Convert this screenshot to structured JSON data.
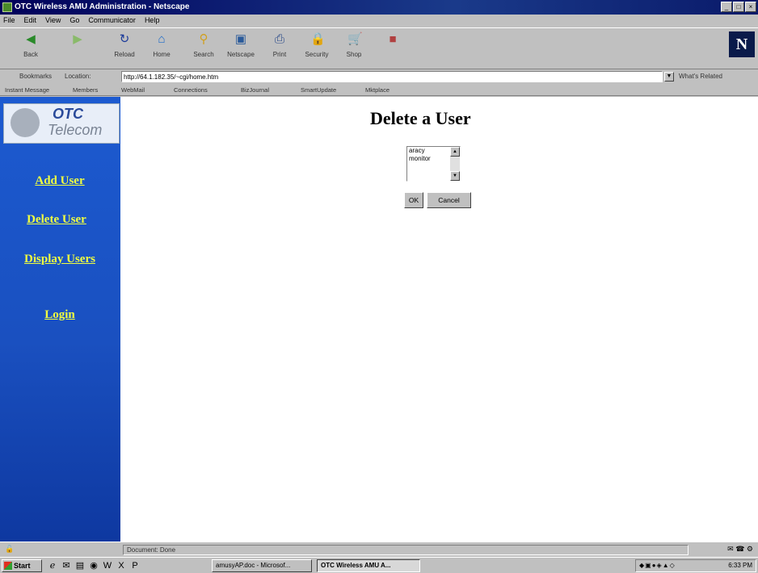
{
  "window": {
    "title": "OTC Wireless AMU Administration - Netscape",
    "controls": [
      "_",
      "□",
      "×"
    ]
  },
  "menu": [
    "File",
    "Edit",
    "View",
    "Go",
    "Communicator",
    "Help"
  ],
  "toolbar": {
    "buttons": [
      {
        "label": "Back",
        "icon": "back-arrow-icon",
        "glyph": "◀"
      },
      {
        "label": "",
        "icon": "forward-arrow-icon",
        "glyph": "▶"
      },
      {
        "label": "Reload",
        "icon": "reload-icon",
        "glyph": "↻"
      },
      {
        "label": "Home",
        "icon": "home-icon",
        "glyph": "⌂"
      },
      {
        "label": "Search",
        "icon": "search-icon",
        "glyph": "⚲"
      },
      {
        "label": "Netscape",
        "icon": "netscape-icon",
        "glyph": "▣"
      },
      {
        "label": "Print",
        "icon": "print-icon",
        "glyph": "⎙"
      },
      {
        "label": "Security",
        "icon": "security-icon",
        "glyph": "🔒"
      },
      {
        "label": "Shop",
        "icon": "shop-icon",
        "glyph": "🛒"
      },
      {
        "label": "",
        "icon": "stop-icon",
        "glyph": "■"
      }
    ],
    "logo": "N"
  },
  "location": {
    "bookmarks_label": "Bookmarks",
    "location_label": "Location:",
    "url": "http://64.1.182.35/~cgi/home.htm",
    "related_label": "What's Related"
  },
  "personal_toolbar": [
    "Instant Message",
    "Members",
    "WebMail",
    "Connections",
    "BizJournal",
    "SmartUpdate",
    "Mktplace"
  ],
  "sidebar": {
    "logo_otc": "OTC",
    "logo_telecom": "Telecom",
    "links": [
      "Add User",
      "Delete User",
      "Display Users",
      "Login"
    ]
  },
  "main": {
    "title": "Delete a User",
    "users": [
      "aracy",
      "monitor"
    ],
    "ok_label": "OK",
    "cancel_label": "Cancel"
  },
  "status": {
    "text": "Document: Done"
  },
  "taskbar": {
    "start_label": "Start",
    "tasks": [
      "amusyAP.doc - Microsof...",
      "OTC Wireless AMU A..."
    ],
    "clock": "6:33 PM"
  }
}
